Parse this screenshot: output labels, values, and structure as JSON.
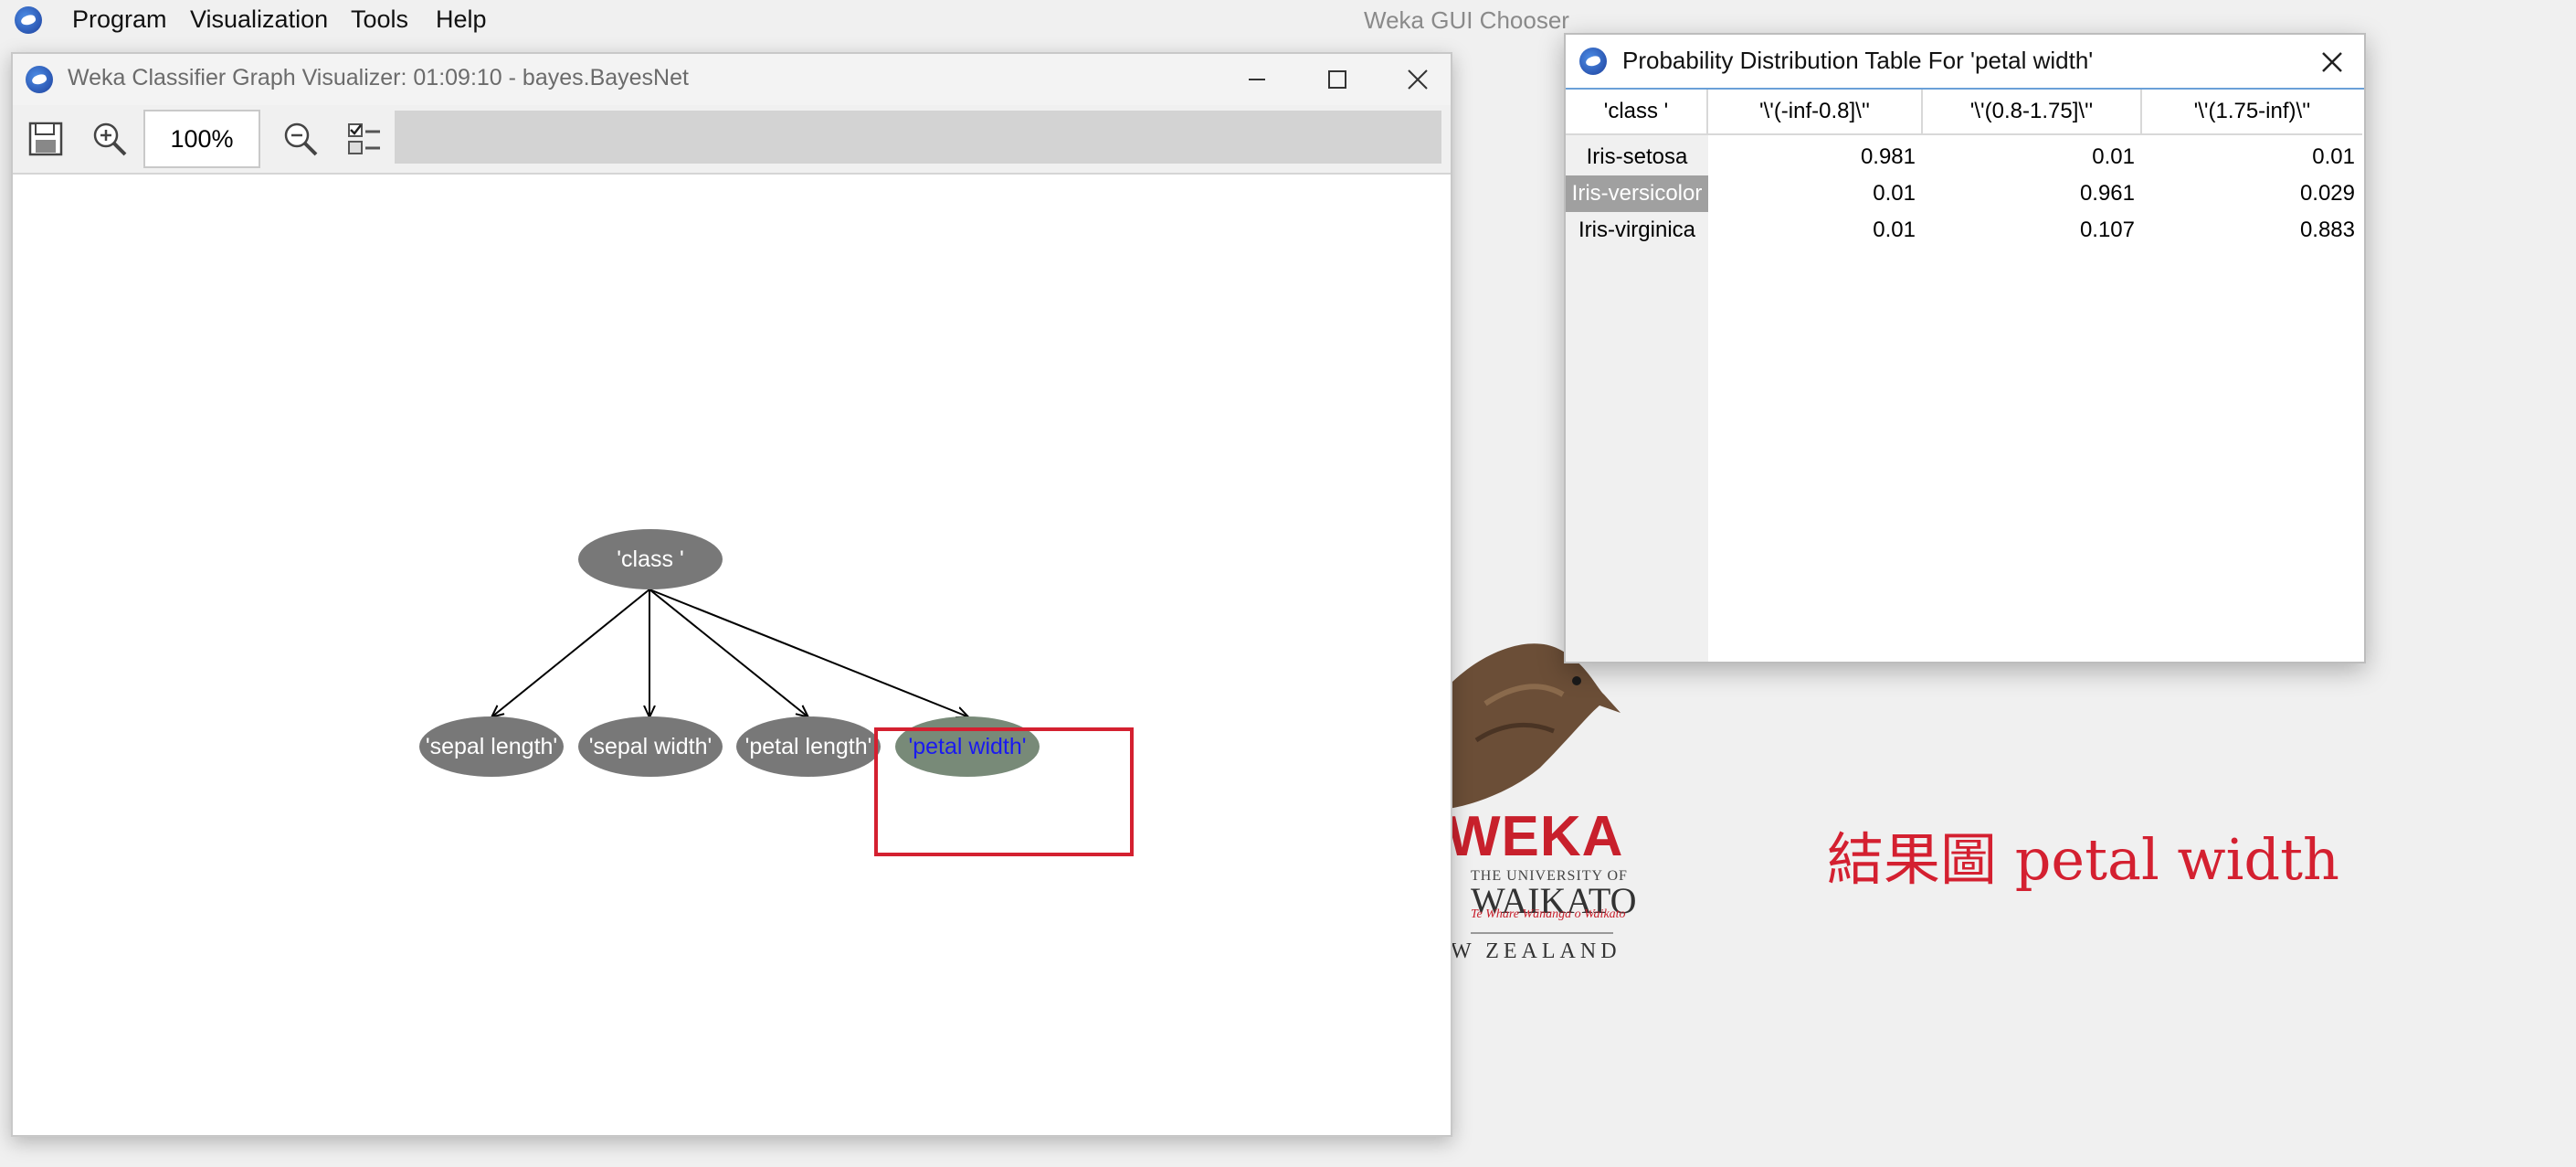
{
  "menubar": {
    "items": [
      "Program",
      "Visualization",
      "Tools",
      "Help"
    ],
    "chooser_title": "Weka GUI Chooser"
  },
  "graph_window": {
    "title": "Weka Classifier Graph Visualizer: 01:09:10 - bayes.BayesNet",
    "zoom_value": "100%",
    "nodes": {
      "class": "'class '",
      "sepal_length": "'sepal length'",
      "sepal_width": "'sepal width'",
      "petal_length": "'petal length'",
      "petal_width": "'petal width'"
    },
    "selected_node": "petal_width",
    "icons": [
      "save-icon",
      "zoom-in-icon",
      "zoom-out-icon",
      "layout-options-icon"
    ]
  },
  "prob_window": {
    "title": "Probability Distribution Table For 'petal width'",
    "headers": [
      "'class '",
      "'\\'(-inf-0.8]\\''",
      "'\\'(0.8-1.75]\\''",
      "'\\'(1.75-inf)\\''"
    ],
    "rows": [
      {
        "label": "Iris-setosa",
        "values": [
          "0.981",
          "0.01",
          "0.01"
        ]
      },
      {
        "label": "Iris-versicolor",
        "values": [
          "0.01",
          "0.961",
          "0.029"
        ]
      },
      {
        "label": "Iris-virginica",
        "values": [
          "0.01",
          "0.107",
          "0.883"
        ]
      }
    ],
    "selected_row": "Iris-versicolor"
  },
  "logo": {
    "brand": "WEKA",
    "university_line": "THE UNIVERSITY OF",
    "university_name": "WAIKATO",
    "motto": "Te Whare Wānanga o Waikato",
    "country": "W ZEALAND"
  },
  "annotation": "結果圖 petal width",
  "colors": {
    "highlight": "#d42030",
    "node_fill": "#787878",
    "selected_node_fill": "#788a78",
    "selected_node_text": "#1a1af0",
    "selected_row": "#a0a0a0"
  }
}
